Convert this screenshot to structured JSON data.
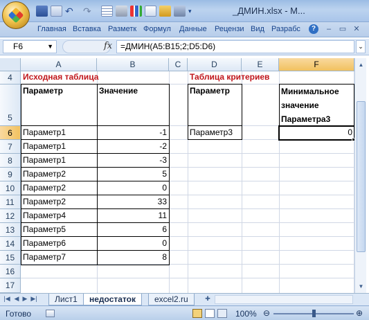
{
  "window": {
    "title": "_ДМИН.xlsx - M...",
    "controls": [
      "minimize-icon",
      "maximize-icon",
      "close-icon"
    ]
  },
  "quick_access": [
    "save-icon",
    "redo-icon",
    "undo-icon",
    "redo-arrow-icon",
    "tool-icon-1",
    "tool-icon-2",
    "tool-icon-3",
    "tool-icon-4",
    "tool-icon-5",
    "tool-icon-6",
    "tool-icon-7"
  ],
  "ribbon": {
    "tabs": [
      "Главная",
      "Вставка",
      "Разметк",
      "Формул",
      "Данные",
      "Рецензи",
      "Вид",
      "Разрабс"
    ],
    "help": "?"
  },
  "formula_bar": {
    "name_box": "F6",
    "fx": "fx",
    "formula": "=ДМИН(A5:B15;2;D5:D6)"
  },
  "columns": [
    "A",
    "B",
    "C",
    "D",
    "E",
    "F"
  ],
  "selected_column": "F",
  "rows": [
    "4",
    "5",
    "6",
    "7",
    "8",
    "9",
    "10",
    "11",
    "12",
    "13",
    "14",
    "15",
    "16",
    "17"
  ],
  "selected_row": "6",
  "cells": {
    "A4": "Исходная таблица",
    "D4": "Таблица критериев",
    "A5": "Параметр",
    "B5": "Значение",
    "D5": "Параметр",
    "F5_line1": "Минимальное",
    "F5_line2": "значение",
    "F5_line3": "Параметра3",
    "D6": "Параметр3",
    "F6": "0"
  },
  "data_rows": [
    {
      "param": "Параметр1",
      "value": "-1"
    },
    {
      "param": "Параметр1",
      "value": "-2"
    },
    {
      "param": "Параметр1",
      "value": "-3"
    },
    {
      "param": "Параметр2",
      "value": "5"
    },
    {
      "param": "Параметр2",
      "value": "0"
    },
    {
      "param": "Параметр2",
      "value": "33"
    },
    {
      "param": "Параметр4",
      "value": "11"
    },
    {
      "param": "Параметр5",
      "value": "6"
    },
    {
      "param": "Параметр6",
      "value": "0"
    },
    {
      "param": "Параметр7",
      "value": "8"
    }
  ],
  "sheet_tabs": [
    "Лист1",
    "недостаток",
    "excel2.ru"
  ],
  "active_sheet": "недостаток",
  "status": {
    "ready": "Готово",
    "zoom": "100%"
  },
  "colors": {
    "header_red": "#c0161b",
    "selection_orange": "#f1c15f",
    "ribbon_blue": "#15428b"
  }
}
